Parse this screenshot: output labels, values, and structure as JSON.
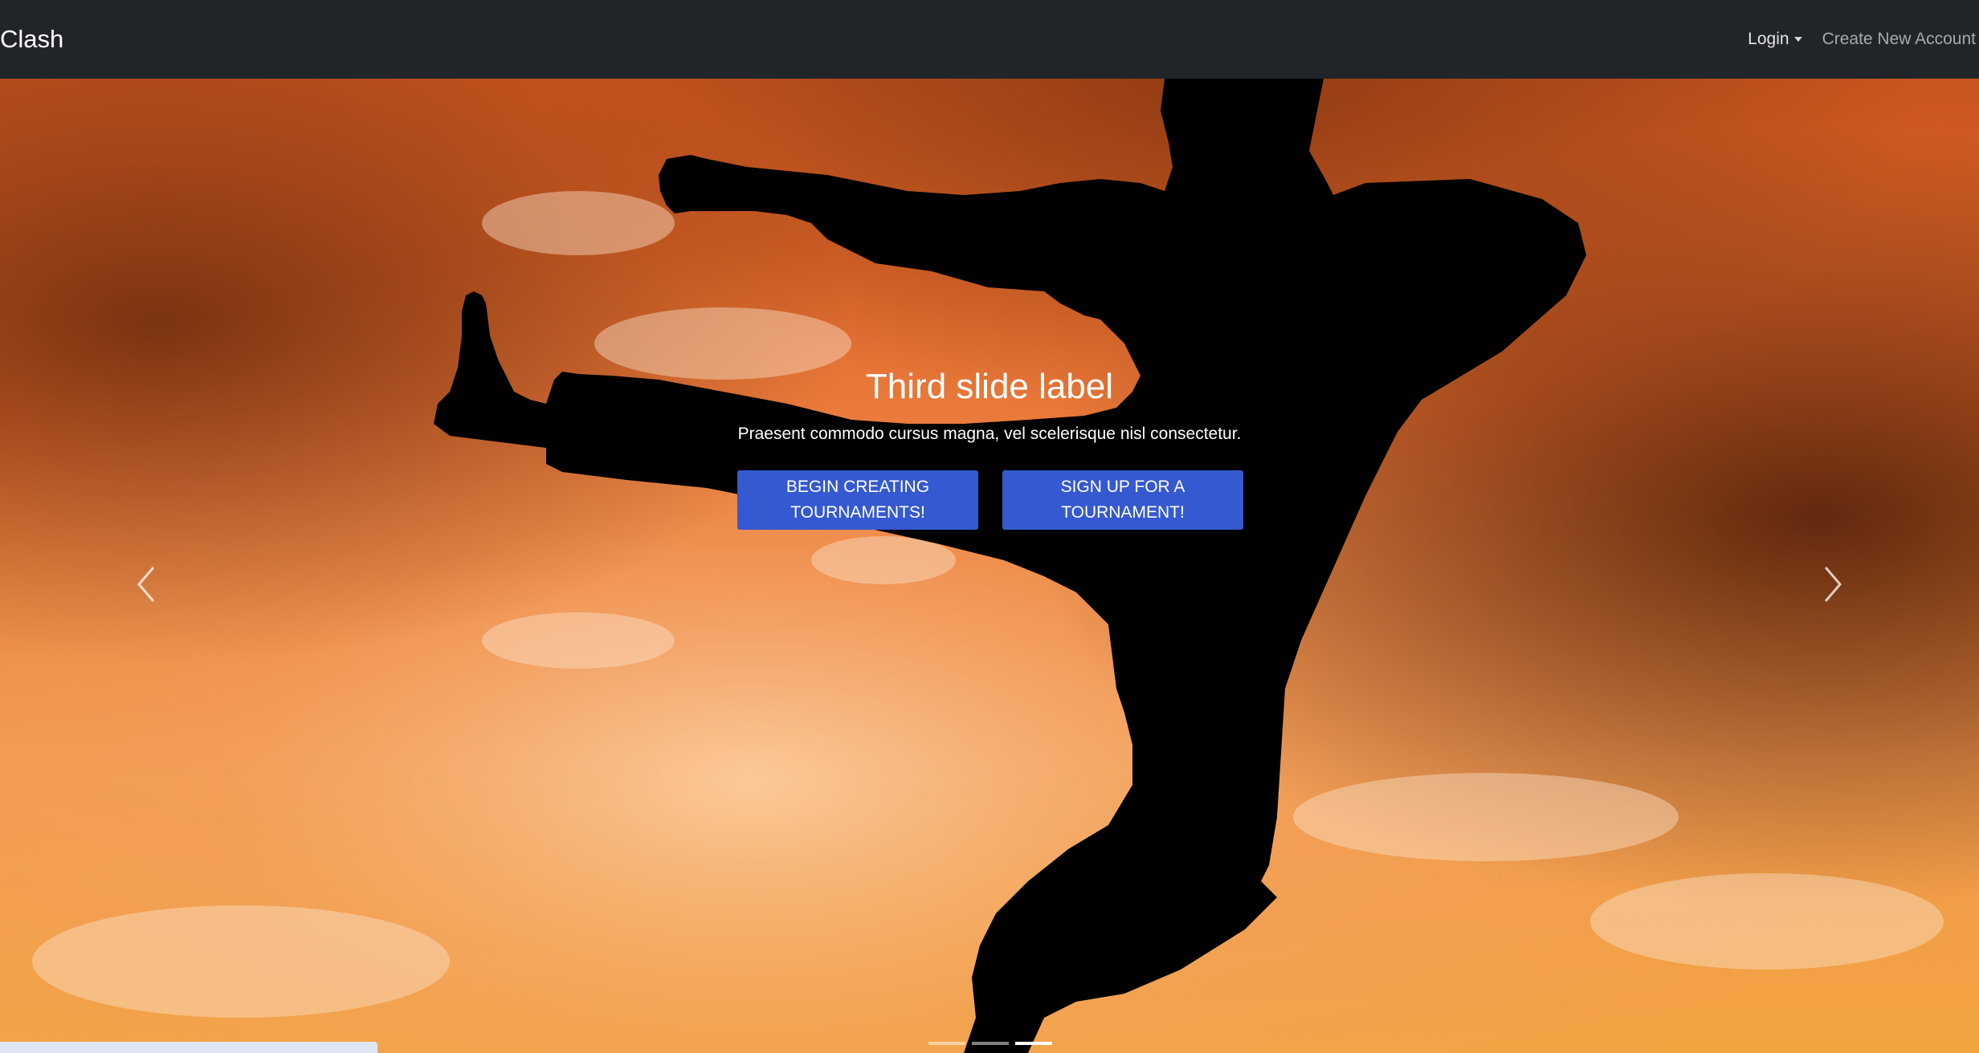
{
  "navbar": {
    "brand": "Clash",
    "login_label": "Login",
    "create_account_label": "Create New Account"
  },
  "carousel": {
    "active_slide": 3,
    "slide_count": 3,
    "caption_title": "Third slide label",
    "caption_text": "Praesent commodo cursus magna, vel scelerisque nisl consectetur.",
    "buttons": [
      {
        "label": "Begin Creating Tournaments!"
      },
      {
        "label": "Sign Up For A Tournament!"
      }
    ]
  },
  "colors": {
    "navbar_bg": "#212529",
    "button_bg": "#3559d1",
    "sky_orange": "#e8722e"
  },
  "icons": {
    "prev": "chevron-left-icon",
    "next": "chevron-right-icon",
    "caret": "caret-down-icon"
  }
}
